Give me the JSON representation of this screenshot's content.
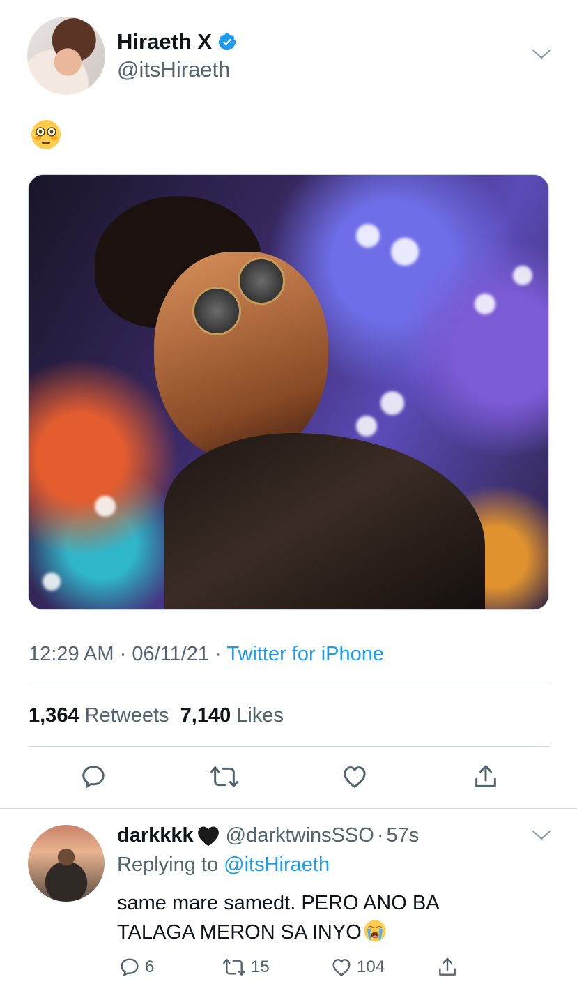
{
  "tweet": {
    "display_name": "Hiraeth X",
    "handle": "@itsHiraeth",
    "text_emoji": "flushed-face-emoji",
    "time": "12:29 AM",
    "sep1": "·",
    "date": "06/11/21",
    "sep2": "·",
    "source": "Twitter for iPhone",
    "retweets_count": "1,364",
    "retweets_label": "Retweets",
    "likes_count": "7,140",
    "likes_label": "Likes"
  },
  "reply": {
    "display_name": "darkkkk",
    "name_emoji": "black-heart-emoji",
    "handle": "@darktwinsSSO",
    "sep": "·",
    "time": "57s",
    "replying_label": "Replying to",
    "replying_handle": "@itsHiraeth",
    "text_line1": "same mare samedt. PERO ANO BA",
    "text_line2": "TALAGA MERON SA INYO",
    "text_emoji": "loudly-crying-face-emoji",
    "reply_count": "6",
    "retweet_count": "15",
    "like_count": "104"
  },
  "colors": {
    "accent": "#1d9bf0",
    "secondary_text": "#536471",
    "primary_text": "#0f1419",
    "divider": "#cfd9de"
  }
}
